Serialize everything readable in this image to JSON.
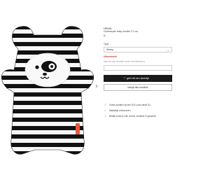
{
  "colors": {
    "accent": "#c7322b",
    "button_dark": "#1a1a1a",
    "tag": "#e8583a"
  },
  "gallery": {
    "next_arrow_icon": "chevron-right-icon",
    "next_arrow_glyph": "›"
  },
  "product": {
    "brand": "HEMA",
    "name": "Gestreepte baby knuffel 21 cm",
    "price": "6,-"
  },
  "variant": {
    "label": "Type",
    "selected": "Streep",
    "chevron": "⌄"
  },
  "availability": {
    "status": "Uitverkocht",
    "notify_text": "Mail me als dit artikel weer beschikbaar is",
    "email_placeholder": ""
  },
  "actions": {
    "wishlist_label": "geef dit een steentje",
    "wishlist_icon": "heart-icon",
    "heart_glyph": "♡",
    "all_label": "bekijk alle knuffels"
  },
  "usps": [
    {
      "text": "Gratis ophalen bij een DHL punt vanaf 20,-",
      "icon": "check-icon",
      "glyph": "✓"
    },
    {
      "text": "Makkelijk retourneren",
      "icon": "check-icon",
      "glyph": "✓"
    },
    {
      "text": "Betaal zoals je wilt: vooraf, achteraf of gespreid",
      "icon": "check-icon",
      "glyph": "✓"
    }
  ]
}
